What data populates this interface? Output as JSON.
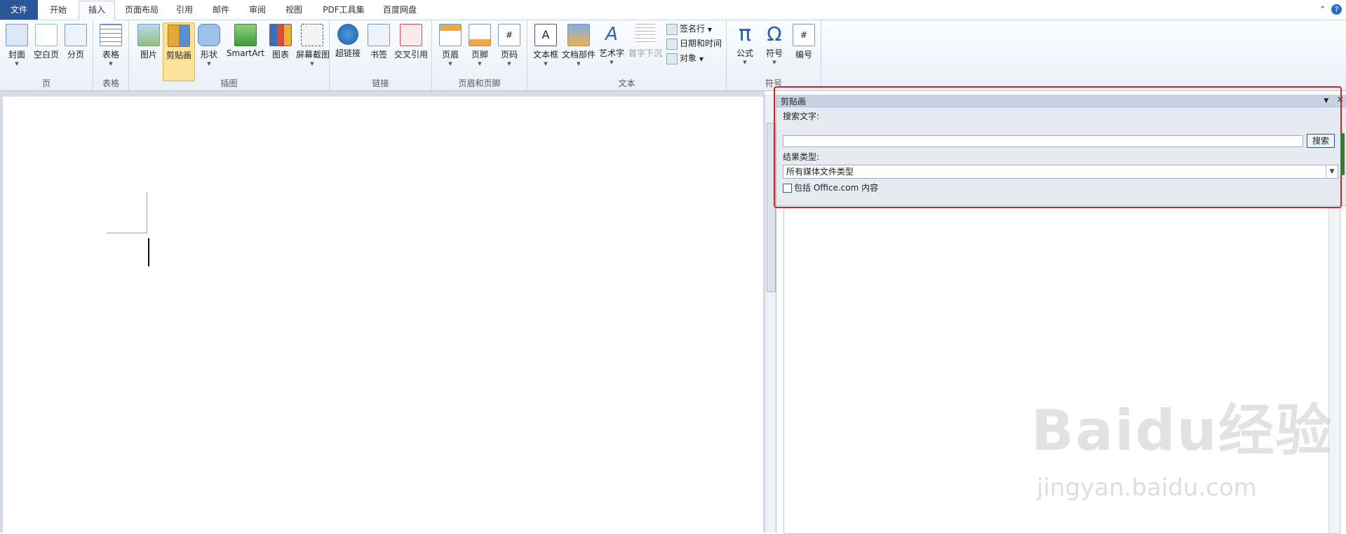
{
  "tabs": [
    "文件",
    "开始",
    "插入",
    "页面布局",
    "引用",
    "邮件",
    "审阅",
    "视图",
    "PDF工具集",
    "百度网盘"
  ],
  "active_tab": "插入",
  "ribbon": {
    "groups": {
      "page": "页",
      "table": "表格",
      "illustration": "插图",
      "links": "链接",
      "header_footer": "页眉和页脚",
      "text": "文本",
      "symbols": "符号"
    },
    "buttons": {
      "cover": "封面",
      "blank": "空白页",
      "pagebreak": "分页",
      "table": "表格",
      "picture": "图片",
      "clipart": "剪贴画",
      "shapes": "形状",
      "smartart": "SmartArt",
      "chart": "图表",
      "screenshot": "屏幕截图",
      "hyperlink": "超链接",
      "bookmark": "书签",
      "crossref": "交叉引用",
      "header": "页眉",
      "footer": "页脚",
      "pagenum": "页码",
      "textbox": "文本框",
      "quickparts": "文档部件",
      "wordart": "艺术字",
      "dropcap": "首字下沉",
      "signature": "签名行",
      "datetime": "日期和时间",
      "object": "对象",
      "equation": "公式",
      "symbol": "符号",
      "number": "编号"
    }
  },
  "pane": {
    "title": "剪贴画",
    "search_label": "搜索文字:",
    "search_value": "",
    "search_button": "搜索",
    "result_type_label": "结果类型:",
    "result_type_value": "所有媒体文件类型",
    "include_office": "包括 Office.com 内容"
  },
  "watermark": {
    "main": "Baidu经验",
    "url": "jingyan.baidu.com"
  }
}
